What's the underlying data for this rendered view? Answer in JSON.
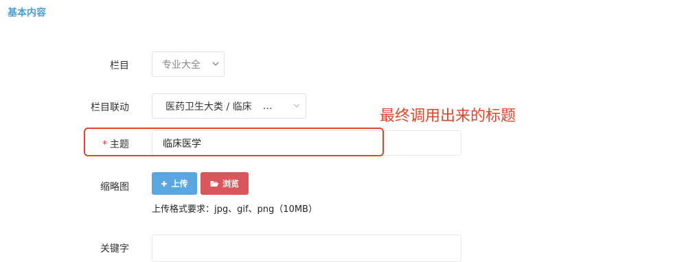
{
  "section": {
    "title": "基本内容"
  },
  "form": {
    "column": {
      "label": "栏目",
      "value": "专业大全"
    },
    "linkage": {
      "label": "栏目联动",
      "value": "医药卫生大类 / 临床",
      "ellipsis": "…"
    },
    "subject": {
      "required_mark": "*",
      "label": "主题",
      "value": "临床医学"
    },
    "thumbnail": {
      "label": "缩略图",
      "upload_label": "上传",
      "browse_label": "浏览",
      "hint": "上传格式要求：jpg、gif、png（10MB）"
    },
    "keywords": {
      "label": "关键字",
      "value": ""
    }
  },
  "annotation": {
    "text": "最终调用出来的标题"
  },
  "colors": {
    "section_title": "#4b9fd5",
    "upload_button": "#5aa6e0",
    "browse_button": "#d9575a",
    "annotation": "#e0452a"
  },
  "icons": [
    "chevron-down-icon",
    "plus-icon",
    "folder-open-icon"
  ]
}
